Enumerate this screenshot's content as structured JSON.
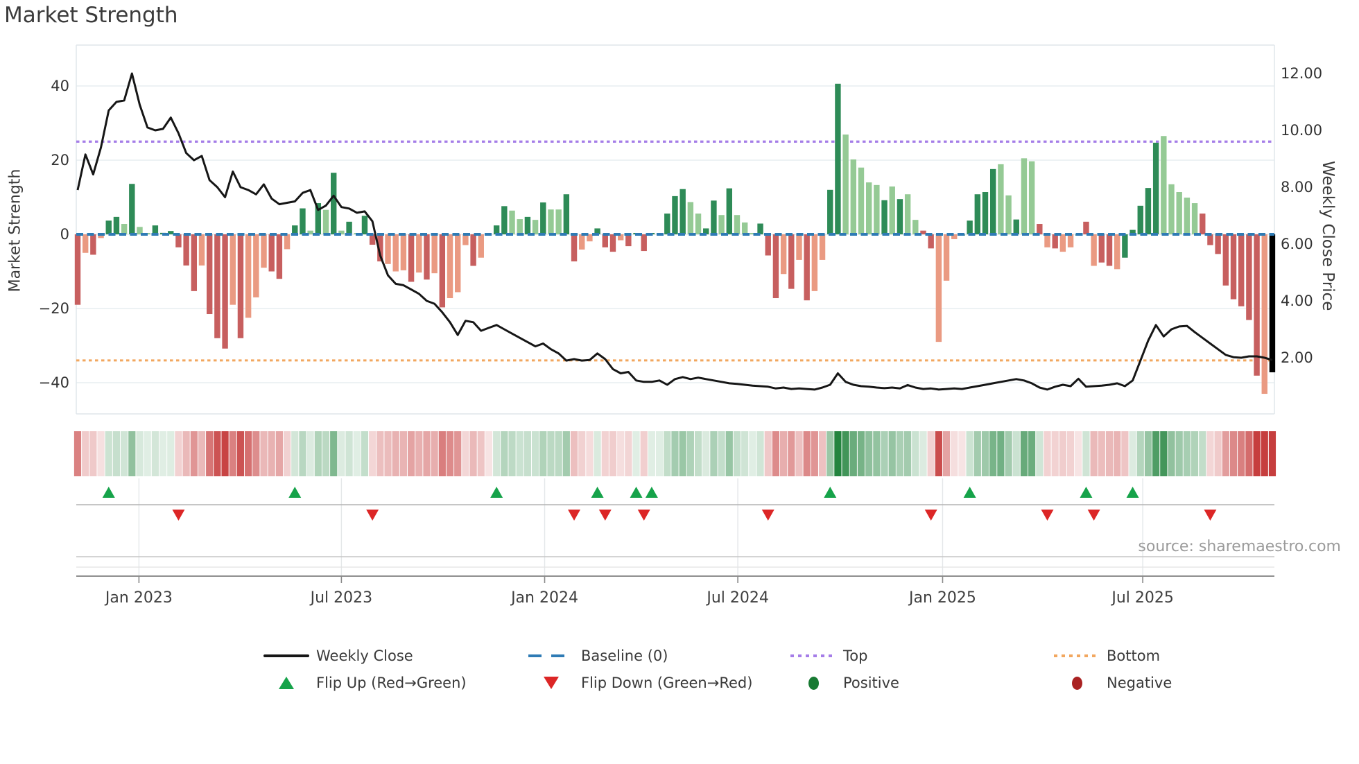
{
  "chart_data": {
    "type": "combo",
    "title": "Market Strength",
    "ylabel_left": "Market Strength",
    "ylabel_right": "Weekly Close Price",
    "source": "source: sharemaestro.com",
    "left_axis": {
      "ticks": [
        40,
        20,
        0,
        -20,
        -40
      ],
      "lim": [
        -48,
        51
      ]
    },
    "right_axis": {
      "ticks": [
        "12.00",
        "10.00",
        "8.00",
        "6.00",
        "4.00",
        "2.00"
      ],
      "tick_values": [
        12,
        10,
        8,
        6,
        4,
        2
      ],
      "lim": [
        0.0,
        13.0
      ]
    },
    "x_ticks": {
      "labels": [
        "Jan 2023",
        "Jul 2023",
        "Jan 2024",
        "Jul 2024",
        "Jan 2025",
        "Jul 2025"
      ],
      "week_positions": [
        7.9,
        34.0,
        60.2,
        85.1,
        111.5,
        137.3
      ]
    },
    "top_line": {
      "label": "Top",
      "strength_value": 25,
      "price_value": 9.6
    },
    "bottom_line": {
      "label": "Bottom",
      "strength_value": -34,
      "price_value": 1.95
    },
    "baseline": {
      "label": "Baseline (0)",
      "value": 0
    },
    "series": [
      {
        "name": "Strength bars",
        "type": "bar",
        "values": [
          -19,
          -5,
          -5.5,
          -1,
          3.7,
          4.7,
          2.8,
          13.6,
          2,
          0.3,
          2.4,
          0.4,
          0.9,
          -3.5,
          -8.4,
          -15.3,
          -8.4,
          -21.5,
          -28,
          -30.8,
          -19,
          -28,
          -22.5,
          -17,
          -9,
          -10,
          -12,
          -4,
          2.4,
          7,
          1,
          8.4,
          6.6,
          16.6,
          1,
          3.4,
          0.3,
          5,
          -2.8,
          -7.3,
          -8,
          -10,
          -9.7,
          -12.8,
          -10.3,
          -12.2,
          -10.5,
          -19.7,
          -17.2,
          -15.6,
          -2.9,
          -8.5,
          -6.3,
          -0.3,
          2.4,
          7.6,
          6.4,
          4.1,
          4.7,
          3.9,
          8.6,
          6.7,
          6.7,
          10.8,
          -7.3,
          -4.1,
          -1.9,
          1.6,
          -3.5,
          -4.7,
          -1.6,
          -3.2,
          0.3,
          -4.5,
          0.3,
          0.2,
          5.6,
          10.3,
          12.2,
          8.7,
          5.6,
          1.6,
          9.1,
          5.2,
          12.4,
          5.2,
          3.2,
          0.3,
          2.9,
          -5.7,
          -17.2,
          -10.7,
          -14.7,
          -6.9,
          -17.8,
          -15.3,
          -6.9,
          12,
          40.6,
          26.9,
          20.2,
          18,
          14,
          13.3,
          9.2,
          12.9,
          9.5,
          10.8,
          3.9,
          1,
          -3.8,
          -29,
          -12.5,
          -1.3,
          -0.3,
          3.7,
          10.8,
          11.4,
          17.6,
          18.9,
          10.5,
          4,
          20.5,
          19.7,
          2.8,
          -3.5,
          -3.8,
          -4.7,
          -3.5,
          -0.3,
          3.4,
          -8.5,
          -7.6,
          -8.5,
          -9.4,
          -6.3,
          1.2,
          7.7,
          12.5,
          24.7,
          26.5,
          13.5,
          11.4,
          9.9,
          8.4,
          5.6,
          -2.9,
          -5.3,
          -13.8,
          -17.5,
          -19.4,
          -23.1,
          -38.1,
          -43,
          -37.2
        ],
        "color_codes": [
          "dr",
          "lr",
          "dr",
          "lr",
          "dg",
          "dg",
          "lg",
          "dg",
          "lg",
          "lg",
          "dg",
          "dg",
          "dg",
          "dr",
          "dr",
          "dr",
          "lr",
          "dr",
          "dr",
          "dr",
          "lr",
          "dr",
          "lr",
          "lr",
          "lr",
          "dr",
          "dr",
          "lr",
          "dg",
          "dg",
          "lg",
          "dg",
          "lg",
          "dg",
          "lg",
          "dg",
          "lg",
          "dg",
          "dr",
          "dr",
          "lr",
          "lr",
          "lr",
          "dr",
          "lr",
          "dr",
          "lr",
          "dr",
          "lr",
          "lr",
          "lr",
          "dr",
          "lr",
          "lr",
          "dg",
          "dg",
          "lg",
          "lg",
          "dg",
          "lg",
          "dg",
          "lg",
          "lg",
          "dg",
          "dr",
          "lr",
          "lr",
          "dg",
          "dr",
          "dr",
          "lr",
          "dr",
          "dg",
          "dr",
          "dg",
          "lg",
          "dg",
          "dg",
          "dg",
          "lg",
          "lg",
          "dg",
          "dg",
          "lg",
          "dg",
          "lg",
          "lg",
          "lg",
          "dg",
          "dr",
          "dr",
          "lr",
          "dr",
          "lr",
          "dr",
          "lr",
          "lr",
          "dg",
          "dg",
          "lg",
          "lg",
          "lg",
          "lg",
          "lg",
          "dg",
          "lg",
          "dg",
          "lg",
          "lg",
          "dr",
          "dr",
          "lr",
          "lr",
          "lr",
          "dg",
          "dg",
          "dg",
          "dg",
          "dg",
          "lg",
          "lg",
          "dg",
          "lg",
          "lg",
          "dr",
          "lr",
          "dr",
          "lr",
          "lr",
          "dg",
          "dr",
          "lr",
          "dr",
          "dr",
          "lr",
          "dg",
          "dg",
          "dg",
          "dg",
          "dg",
          "lg",
          "lg",
          "lg",
          "lg",
          "lg",
          "dr",
          "dr",
          "dr",
          "dr",
          "dr",
          "dr",
          "dr",
          "dr",
          "lr"
        ]
      },
      {
        "name": "Weekly Close",
        "type": "line",
        "values": [
          7.9,
          9.15,
          8.45,
          9.4,
          10.7,
          11,
          11.05,
          12,
          10.9,
          10.1,
          10,
          10.05,
          10.45,
          9.9,
          9.2,
          8.95,
          9.1,
          8.25,
          8,
          7.65,
          8.55,
          8,
          7.9,
          7.75,
          8.1,
          7.6,
          7.4,
          7.45,
          7.5,
          7.8,
          7.9,
          7.2,
          7.35,
          7.7,
          7.3,
          7.25,
          7.1,
          7.15,
          6.8,
          5.6,
          4.9,
          4.6,
          4.55,
          4.4,
          4.25,
          4,
          3.9,
          3.6,
          3.25,
          2.8,
          3.3,
          3.25,
          2.95,
          3.05,
          3.15,
          3,
          2.85,
          2.7,
          2.55,
          2.4,
          2.5,
          2.3,
          2.15,
          1.9,
          1.95,
          1.9,
          1.92,
          2.15,
          1.95,
          1.6,
          1.45,
          1.5,
          1.2,
          1.15,
          1.15,
          1.2,
          1.05,
          1.25,
          1.32,
          1.25,
          1.3,
          1.25,
          1.2,
          1.15,
          1.1,
          1.08,
          1.05,
          1.02,
          1,
          0.98,
          0.92,
          0.95,
          0.9,
          0.92,
          0.9,
          0.88,
          0.95,
          1.05,
          1.45,
          1.15,
          1.05,
          1,
          0.98,
          0.95,
          0.93,
          0.95,
          0.92,
          1.04,
          0.95,
          0.9,
          0.92,
          0.88,
          0.9,
          0.92,
          0.9,
          0.95,
          1,
          1.05,
          1.1,
          1.15,
          1.2,
          1.25,
          1.2,
          1.1,
          0.95,
          0.88,
          0.98,
          1.05,
          1,
          1.26,
          0.98,
          1,
          1.02,
          1.05,
          1.1,
          1,
          1.2,
          1.9,
          2.6,
          3.15,
          2.75,
          3,
          3.1,
          3.12,
          2.9,
          2.7,
          2.5,
          2.3,
          2.1,
          2.02,
          2,
          2.05,
          2.05,
          2,
          1.92
        ]
      }
    ],
    "flip_up_weeks": [
      4,
      28,
      54,
      67,
      72,
      74,
      97,
      115,
      130,
      136
    ],
    "flip_down_weeks": [
      13,
      38,
      64,
      68,
      73,
      89,
      110,
      125,
      131,
      146
    ],
    "heatmap": {
      "description": "weekly stripe, green for positive strength, red for negative, opacity scales with magnitude"
    },
    "grid": true,
    "colors": {
      "bar_dark_green": "#2e8b57",
      "bar_light_green": "#95ca95",
      "bar_dark_red": "#c75f5f",
      "bar_light_red": "#ea9a82",
      "baseline_blue": "#2f7bb5",
      "top_purple": "#a57de8",
      "bottom_orange": "#f2a75f",
      "price_line": "#161616",
      "flip_up_green": "#16a34a",
      "flip_down_red": "#dc2626",
      "positive_dot": "#187a33",
      "negative_dot": "#aa2222",
      "gridline": "#e7edf1",
      "heat_pos": "35,132,62",
      "heat_neg": "198,62,62"
    }
  },
  "legend": {
    "rows": [
      [
        {
          "swatch": "sw-line",
          "label": "Weekly Close"
        },
        {
          "swatch": "sw-dash",
          "label": "Baseline (0)"
        },
        {
          "swatch": "sw-dotp",
          "label": "Top"
        },
        {
          "swatch": "sw-doto",
          "label": "Bottom"
        }
      ],
      [
        {
          "swatch": "sw-triup",
          "label": "Flip Up (Red→Green)"
        },
        {
          "swatch": "sw-tridn",
          "label": "Flip Down (Green→Red)"
        },
        {
          "swatch": "sw-cirg",
          "label": "Positive"
        },
        {
          "swatch": "sw-cirr",
          "label": "Negative"
        }
      ]
    ]
  }
}
